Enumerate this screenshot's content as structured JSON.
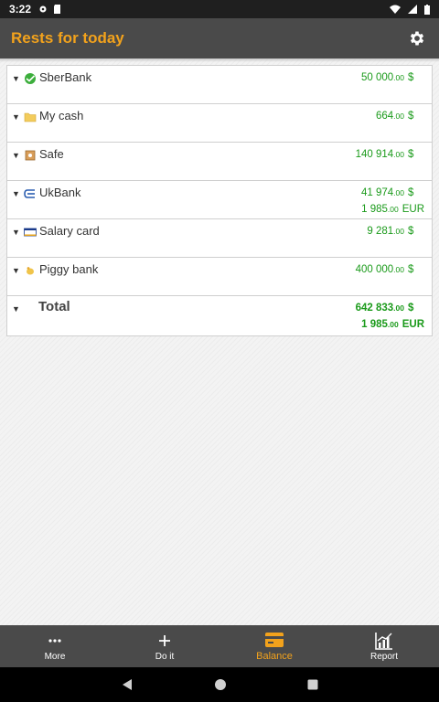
{
  "status_bar": {
    "time": "3:22"
  },
  "header": {
    "title": "Rests for today"
  },
  "accounts": [
    {
      "name": "SberBank",
      "icon": "sberbank-icon",
      "balances": [
        {
          "int": "50 000",
          "cents": ".00",
          "currency": "$"
        }
      ]
    },
    {
      "name": "My cash",
      "icon": "folder-icon",
      "balances": [
        {
          "int": "664",
          "cents": ".00",
          "currency": "$"
        }
      ]
    },
    {
      "name": "Safe",
      "icon": "safe-icon",
      "balances": [
        {
          "int": "140 914",
          "cents": ".00",
          "currency": "$"
        }
      ]
    },
    {
      "name": "UkBank",
      "icon": "ukbank-icon",
      "balances": [
        {
          "int": "41 974",
          "cents": ".00",
          "currency": "$"
        },
        {
          "int": "1 985",
          "cents": ".00",
          "currency": "EUR"
        }
      ]
    },
    {
      "name": "Salary card",
      "icon": "visa-card-icon",
      "balances": [
        {
          "int": "9 281",
          "cents": ".00",
          "currency": "$"
        }
      ]
    },
    {
      "name": "Piggy bank",
      "icon": "piggy-bank-icon",
      "balances": [
        {
          "int": "400 000",
          "cents": ".00",
          "currency": "$"
        }
      ]
    }
  ],
  "total": {
    "label": "Total",
    "balances": [
      {
        "int": "642 833",
        "cents": ".00",
        "currency": "$"
      },
      {
        "int": "1 985",
        "cents": ".00",
        "currency": "EUR"
      }
    ]
  },
  "bottom_nav": [
    {
      "label": "More",
      "icon": "more-dots-icon"
    },
    {
      "label": "Do it",
      "icon": "plus-icon"
    },
    {
      "label": "Balance",
      "icon": "card-icon"
    },
    {
      "label": "Report",
      "icon": "chart-icon"
    }
  ],
  "colors": {
    "accent": "#f2a21c",
    "amount": "#1a9a1a",
    "bar": "#4a4a4a"
  }
}
